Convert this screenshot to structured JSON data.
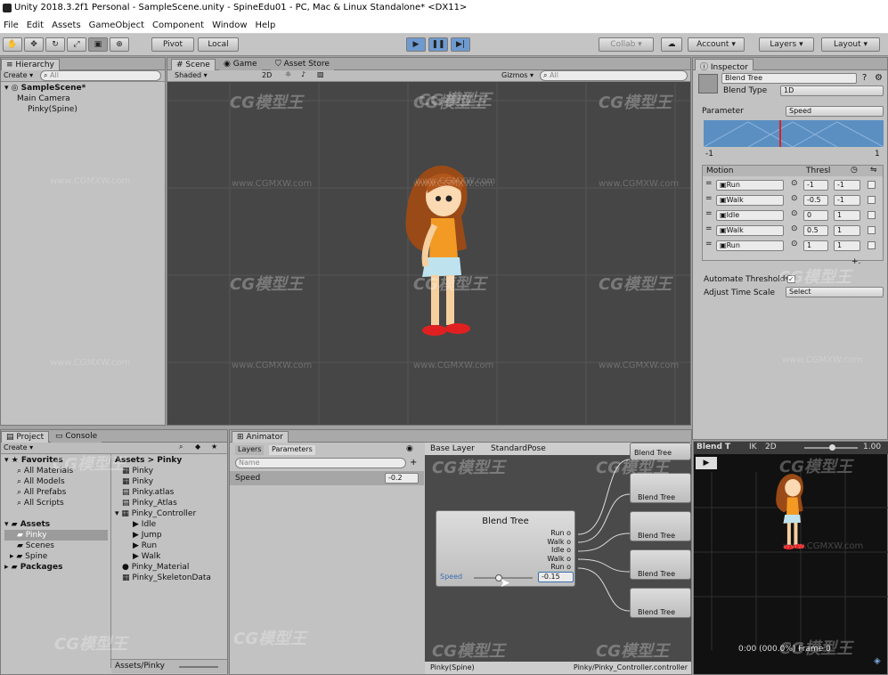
{
  "window": {
    "title": "Unity 2018.3.2f1 Personal - SampleScene.unity - SpineEdu01 - PC, Mac & Linux Standalone* <DX11>"
  },
  "menu": [
    "File",
    "Edit",
    "Assets",
    "GameObject",
    "Component",
    "Window",
    "Help"
  ],
  "toolbar": {
    "pivot": "Pivot",
    "local": "Local",
    "collab": "Collab",
    "account": "Account",
    "layers": "Layers",
    "layout": "Layout"
  },
  "hierarchy": {
    "tab": "Hierarchy",
    "create": "Create",
    "search_placeholder": "All",
    "scene": "SampleScene*",
    "items": [
      "Main Camera",
      "Pinky(Spine)"
    ]
  },
  "scene": {
    "tabs": [
      "Scene",
      "Game",
      "Asset Store"
    ],
    "shading": "Shaded",
    "mode2d": "2D",
    "gizmos": "Gizmos",
    "search_placeholder": "All"
  },
  "inspector": {
    "tab": "Inspector",
    "name": "Blend Tree",
    "blend_type_label": "Blend Type",
    "blend_type": "1D",
    "parameter_label": "Parameter",
    "parameter": "Speed",
    "range_min": "-1",
    "range_max": "1",
    "motion_header": "Motion",
    "thresh_header": "Thresl",
    "motions": [
      {
        "name": "Run",
        "thresh": "-1",
        "value": "-1"
      },
      {
        "name": "Walk",
        "thresh": "-0.5",
        "value": "-1"
      },
      {
        "name": "Idle",
        "thresh": "0",
        "value": "1"
      },
      {
        "name": "Walk",
        "thresh": "0.5",
        "value": "1"
      },
      {
        "name": "Run",
        "thresh": "1",
        "value": "1"
      }
    ],
    "add": "+.",
    "auto_thresh": "Automate Thresholds",
    "adjust_scale": "Adjust Time Scale",
    "select": "Select"
  },
  "project": {
    "tabs": [
      "Project",
      "Console"
    ],
    "create": "Create",
    "favorites": "Favorites",
    "fav_items": [
      "All Materials",
      "All Models",
      "All Prefabs",
      "All Scripts"
    ],
    "assets": "Assets",
    "asset_folders": [
      "Pinky",
      "Scenes",
      "Spine"
    ],
    "packages": "Packages",
    "breadcrumb_root": "Assets",
    "breadcrumb_sep": ">",
    "breadcrumb_current": "Pinky",
    "files": [
      "Pinky",
      "Pinky",
      "Pinky.atlas",
      "Pinky_Atlas",
      "Pinky_Controller"
    ],
    "clips": [
      "Idle",
      "Jump",
      "Run",
      "Walk"
    ],
    "files2": [
      "Pinky_Material",
      "Pinky_SkeletonData"
    ],
    "footer": "Assets/Pinky"
  },
  "animator": {
    "tab": "Animator",
    "layers_tab": "Layers",
    "params_tab": "Parameters",
    "search_placeholder": "Name",
    "param_name": "Speed",
    "param_value": "-0.2",
    "breadcrumb": [
      "Base Layer",
      "StandardPose"
    ],
    "node_title": "Blend Tree",
    "outputs": [
      "Run",
      "Walk",
      "Idle",
      "Walk",
      "Run"
    ],
    "speed_label": "Speed",
    "speed_value": "-0.15",
    "speed_fraction": 0.43,
    "children": [
      "Blend Tree",
      "Blend Tree",
      "Blend Tree",
      "Blend Tree"
    ],
    "footer_left": "Pinky(Spine)",
    "footer_right": "Pinky/Pinky_Controller.controller"
  },
  "preview": {
    "title": "Blend T",
    "ik": "IK",
    "mode2d": "2D",
    "speed": "1.00",
    "time": "0:00 (000.0%) Frame 0"
  },
  "watermark": {
    "logo": "CG模型王",
    "url": "www.CGMXW.com"
  },
  "colors": {
    "scene_bg": "#464646",
    "anim_bg": "#4a4a4a",
    "preview_bg": "#111111",
    "accent": "#6e9ad0"
  }
}
